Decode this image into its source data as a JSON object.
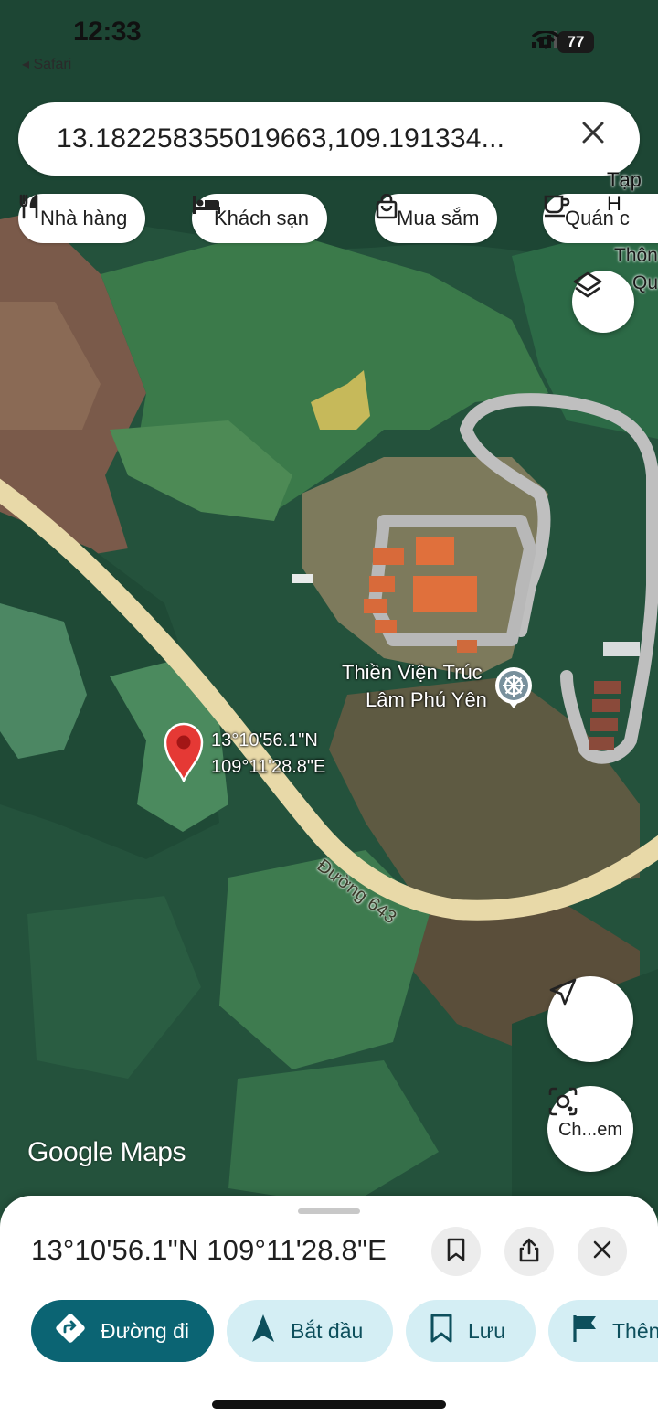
{
  "status_bar": {
    "time": "12:33",
    "back_app": "◂ Safari",
    "battery": "77"
  },
  "search": {
    "query": "13.182258355019663,109.191334..."
  },
  "chips": [
    {
      "label": "Nhà hàng",
      "icon": "fork-knife-icon"
    },
    {
      "label": "Khách sạn",
      "icon": "bed-icon"
    },
    {
      "label": "Mua sắm",
      "icon": "shopping-bag-icon"
    },
    {
      "label": "Quán c",
      "icon": "coffee-cup-icon"
    }
  ],
  "map": {
    "labels": {
      "tap_hoa": "Tạp H",
      "thon_1": "Thôn",
      "thon_2": "Qu",
      "monastery_1": "Thiền Viện Trúc",
      "monastery_2": "Lâm Phú Yên",
      "pin_lat": "13°10'56.1\"N",
      "pin_lng": "109°11'28.8\"E",
      "road": "Đường 643"
    },
    "watermark_google": "Google",
    "watermark_maps": "Maps",
    "lens_label": "Ch...em"
  },
  "sheet": {
    "title": "13°10'56.1\"N 109°11'28.8\"E",
    "actions": [
      {
        "label": "Đường đi",
        "icon": "directions-icon"
      },
      {
        "label": "Bắt đầu",
        "icon": "navigation-arrow-icon"
      },
      {
        "label": "Lưu",
        "icon": "bookmark-icon"
      },
      {
        "label": "Thên",
        "icon": "flag-icon"
      }
    ]
  },
  "colors": {
    "accent": "#0b6473",
    "pin": "#e53935",
    "road": "#e8d9a8",
    "roof": "#e07040"
  }
}
